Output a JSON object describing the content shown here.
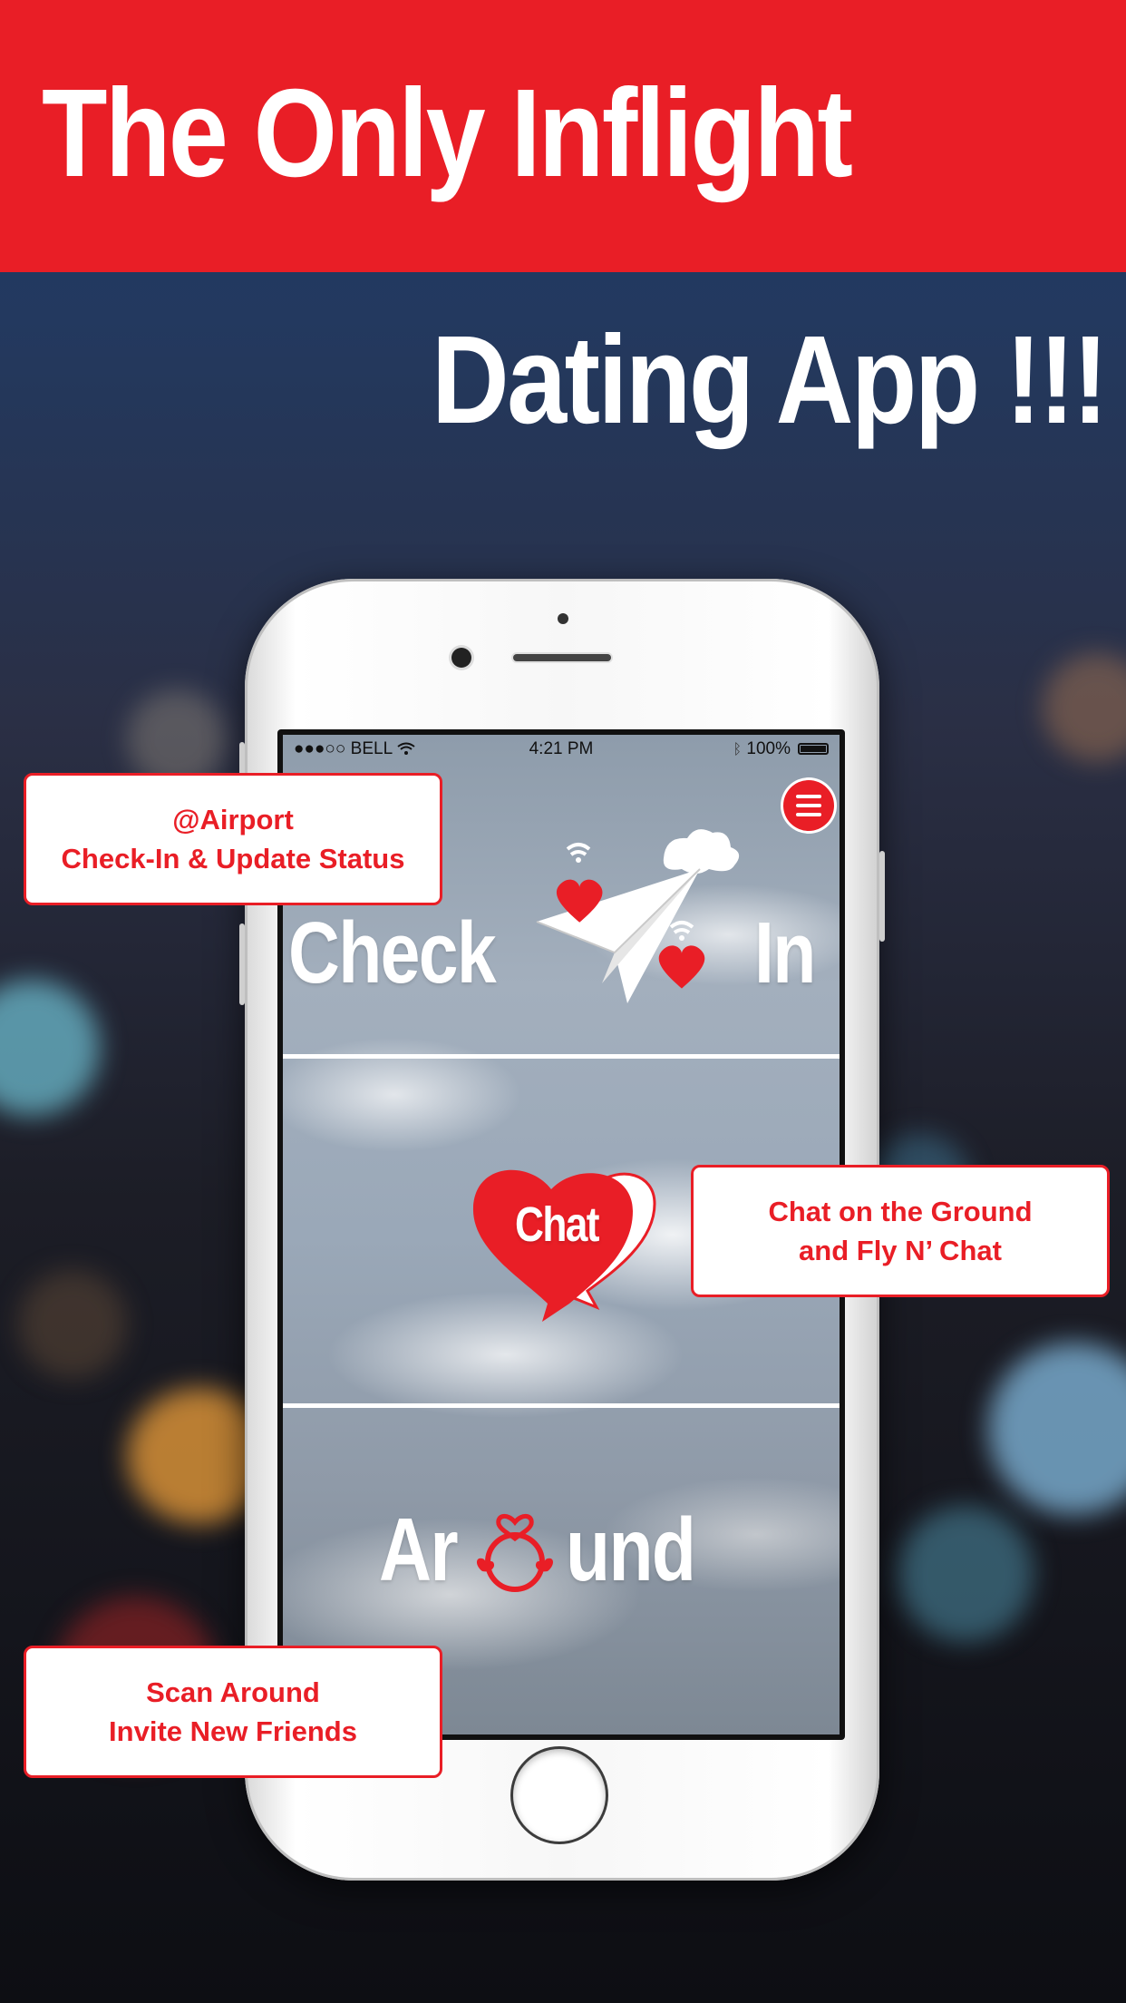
{
  "banner": {
    "line1": "The Only Inflight",
    "line2": "Dating App !!!"
  },
  "phone": {
    "status_bar": {
      "carrier": "●●●○○ BELL",
      "time": "4:21 PM",
      "battery": "100%"
    },
    "menu_icon": "hamburger-menu-icon",
    "sections": [
      {
        "id": "check-in",
        "label_left": "Check",
        "label_right": "In",
        "icon": "paper-plane-hearts-icon"
      },
      {
        "id": "chat",
        "label": "Chat",
        "icon": "heart-chat-bubble-icon"
      },
      {
        "id": "around",
        "label_left": "Ar",
        "label_right": "und",
        "icon": "heart-people-icon"
      }
    ]
  },
  "callouts": {
    "airport": {
      "line1": "@Airport",
      "line2": "Check-In & Update Status"
    },
    "chat": {
      "line1": "Chat on the Ground",
      "line2": "and Fly N’ Chat"
    },
    "scan": {
      "line1": "Scan Around",
      "line2": "Invite New Friends"
    }
  },
  "colors": {
    "brand_red": "#e91e26",
    "white": "#ffffff"
  }
}
